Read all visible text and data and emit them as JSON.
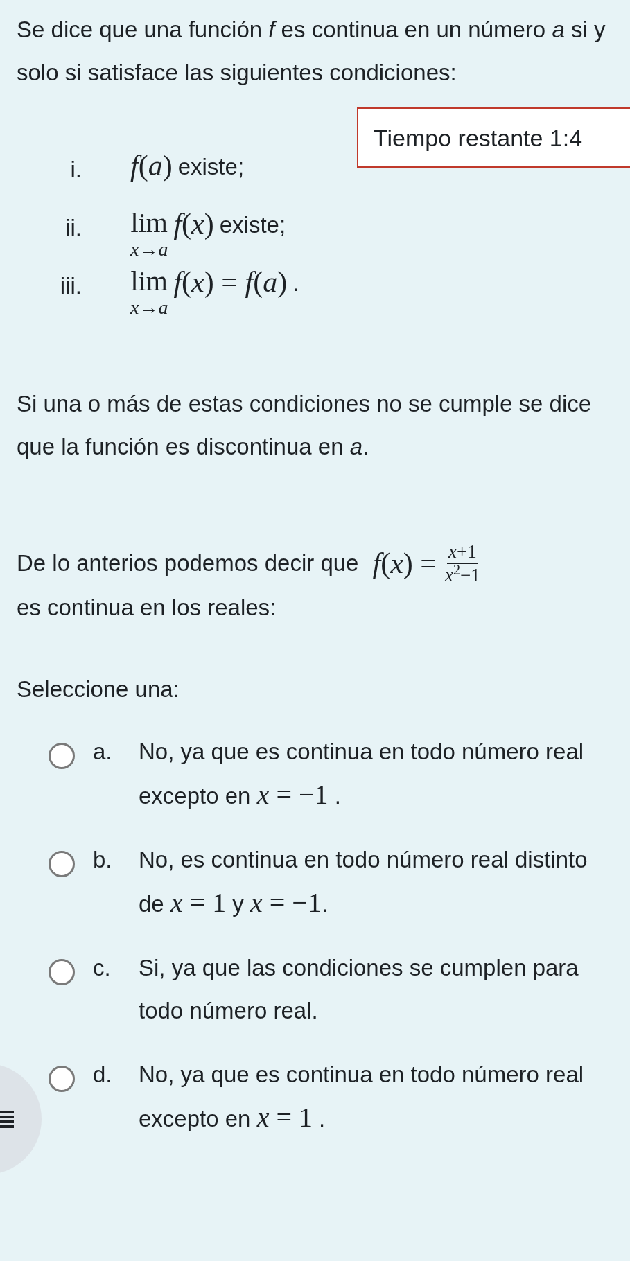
{
  "intro": "Se dice que una función *f* es continua en un número *a* si y solo si satisface las siguientes condiciones:",
  "timer": {
    "text": "Tiempo restante 1:4"
  },
  "conditions": [
    {
      "label": "i.",
      "kind": "plain",
      "math": "*f*(*a*)",
      "text": "existe;"
    },
    {
      "label": "ii.",
      "kind": "limit",
      "lim": "lim",
      "sub": "*x*→*a*",
      "math": "*f*(*x*)",
      "text": "existe;"
    },
    {
      "label": "iii.",
      "kind": "limit",
      "lim": "lim",
      "sub": "*x*→*a*",
      "math": "*f*(*x*) = *f*(*a*)",
      "text": "."
    }
  ],
  "discontinuity": "Si una o más de estas condiciones no se cumple se dice que la función es discontinua en *a*.",
  "question": {
    "before": "De lo anterios podemos decir que",
    "lhs": "*f*(*x*) =",
    "numerator": "*x*+1",
    "denominator": "*x*$^{2}$−1",
    "after": "es continua en los reales:"
  },
  "prompt": "Seleccione una:",
  "options": [
    {
      "letter": "a.",
      "selected": false,
      "parts": [
        {
          "kind": "text",
          "s": "No, ya que es continua en todo número real excepto en "
        },
        {
          "kind": "math",
          "s": "*x* = −1"
        },
        {
          "kind": "text",
          "s": " ."
        }
      ]
    },
    {
      "letter": "b.",
      "selected": false,
      "parts": [
        {
          "kind": "text",
          "s": "No, es continua en todo número real distinto de "
        },
        {
          "kind": "math",
          "s": "*x* = 1"
        },
        {
          "kind": "text",
          "s": " y "
        },
        {
          "kind": "math",
          "s": "*x* = −1"
        },
        {
          "kind": "text",
          "s": "."
        }
      ]
    },
    {
      "letter": "c.",
      "selected": false,
      "parts": [
        {
          "kind": "text",
          "s": "Si, ya que las condiciones se cumplen para todo número real."
        }
      ]
    },
    {
      "letter": "d.",
      "selected": false,
      "parts": [
        {
          "kind": "text",
          "s": "No, ya que es continua en todo número real excepto en "
        },
        {
          "kind": "math",
          "s": "*x* = 1"
        },
        {
          "kind": "text",
          "s": " ."
        }
      ]
    }
  ]
}
